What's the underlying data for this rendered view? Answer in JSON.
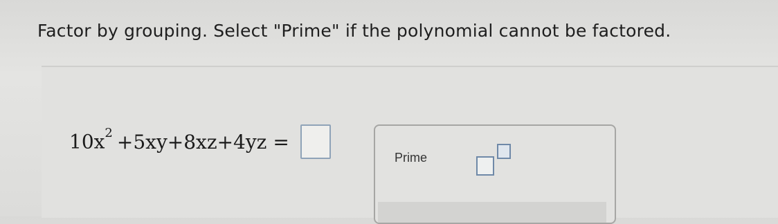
{
  "instruction": "Factor by grouping. Select \"Prime\" if the polynomial cannot be factored.",
  "equation": {
    "part1": "10x",
    "exp": "2",
    "part2": "+5xy+8xz+4yz ="
  },
  "answer": {
    "value": ""
  },
  "tools": {
    "prime_label": "Prime",
    "exponent_icon": "superscript-template-icon"
  }
}
